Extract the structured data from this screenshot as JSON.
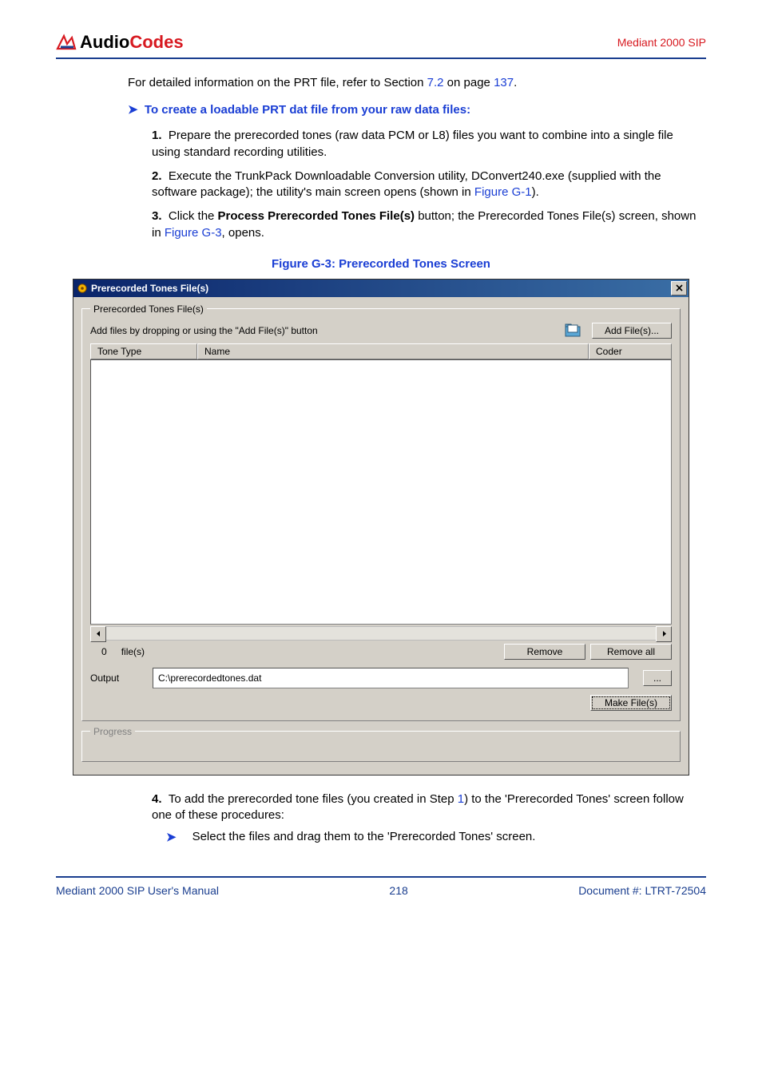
{
  "header": {
    "logo_text_1": "Audio",
    "logo_text_2": "Codes",
    "right": "Mediant 2000 SIP"
  },
  "intro": {
    "line": "For detailed information on the PRT file, refer to Section ",
    "link1": "7.2",
    "mid": " on page ",
    "link2": "137",
    "end": "."
  },
  "procedure_head": "To create a loadable PRT dat file from your raw data files:",
  "steps": {
    "s1_num": "1.",
    "s1": "Prepare the prerecorded tones (raw data PCM or L8) files you want to combine into a single file using standard recording utilities.",
    "s2_num": "2.",
    "s2_a": "Execute the TrunkPack Downloadable Conversion utility, DConvert240.exe (supplied with the software package); the utility's main screen opens (shown in ",
    "s2_link": "Figure G-1",
    "s2_b": ").",
    "s3_num": "3.",
    "s3_a": "Click the ",
    "s3_bold": "Process Prerecorded Tones File(s)",
    "s3_b": " button; the Prerecorded Tones File(s) screen, shown in ",
    "s3_link": "Figure G-3",
    "s3_c": ", opens."
  },
  "figure_caption": "Figure G-3: Prerecorded Tones Screen",
  "dialog": {
    "title": "Prerecorded Tones File(s)",
    "group_label": "Prerecorded Tones File(s)",
    "add_hint": "Add files by dropping or using the \"Add File(s)\" button",
    "add_btn": "Add File(s)...",
    "col1": "Tone Type",
    "col2": "Name",
    "col3": "Coder",
    "count_num": "0",
    "count_label": "file(s)",
    "remove_btn": "Remove",
    "removeall_btn": "Remove all",
    "output_label": "Output",
    "output_value": "C:\\prerecordedtones.dat",
    "browse_btn": "...",
    "make_btn": "Make File(s)",
    "progress_label": "Progress"
  },
  "post_steps": {
    "s4_num": "4.",
    "s4_a": "To add the prerecorded tone files (you created in Step ",
    "s4_link": "1",
    "s4_b": ") to the 'Prerecorded Tones' screen follow one of these procedures:",
    "bullet": "Select the files and drag them to the 'Prerecorded Tones' screen."
  },
  "footer": {
    "left": "Mediant 2000 SIP User's Manual",
    "center": "218",
    "right": "Document #: LTRT-72504"
  }
}
